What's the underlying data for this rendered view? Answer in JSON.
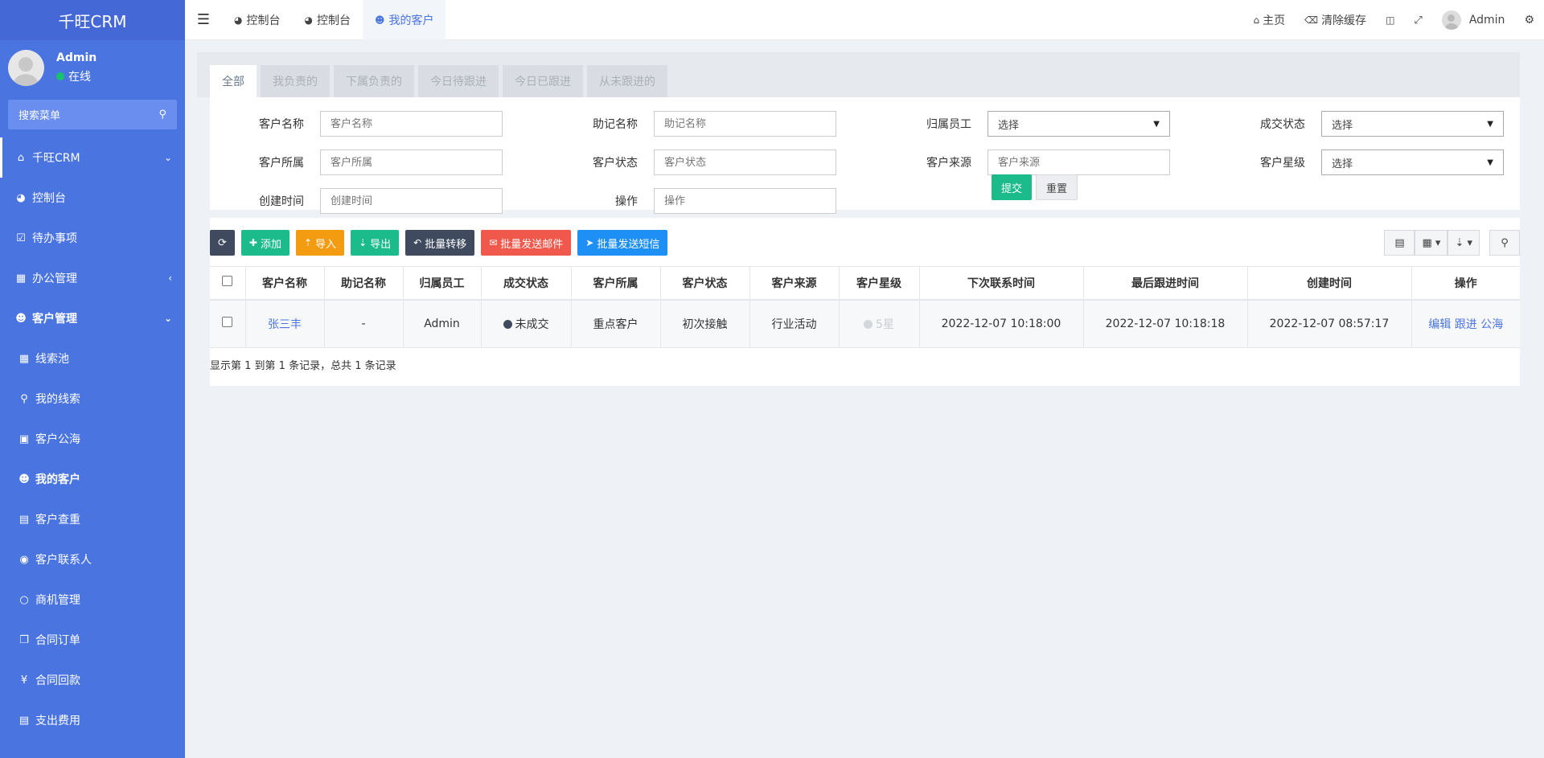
{
  "app": {
    "brand": "千旺CRM"
  },
  "user": {
    "name": "Admin",
    "status": "在线"
  },
  "sidebar": {
    "search_placeholder": "搜索菜单",
    "items": [
      {
        "label": "千旺CRM"
      },
      {
        "label": "控制台"
      },
      {
        "label": "待办事项"
      },
      {
        "label": "办公管理"
      },
      {
        "label": "客户管理"
      },
      {
        "label": "线索池"
      },
      {
        "label": "我的线索"
      },
      {
        "label": "客户公海"
      },
      {
        "label": "我的客户"
      },
      {
        "label": "客户查重"
      },
      {
        "label": "客户联系人"
      },
      {
        "label": "商机管理"
      },
      {
        "label": "合同订单"
      },
      {
        "label": "合同回款"
      },
      {
        "label": "支出费用"
      }
    ]
  },
  "topbar": {
    "tabs": [
      {
        "label": "控制台"
      },
      {
        "label": "控制台"
      },
      {
        "label": "我的客户"
      }
    ],
    "home": "主页",
    "clear_cache": "清除缓存",
    "admin": "Admin"
  },
  "filter_tabs": [
    "全部",
    "我负责的",
    "下属负责的",
    "今日待跟进",
    "今日已跟进",
    "从未跟进的"
  ],
  "filters": {
    "customer_name": {
      "label": "客户名称",
      "placeholder": "客户名称"
    },
    "mnemonic": {
      "label": "助记名称",
      "placeholder": "助记名称"
    },
    "owner": {
      "label": "归属员工",
      "value": "选择"
    },
    "deal_status": {
      "label": "成交状态",
      "value": "选择"
    },
    "belong": {
      "label": "客户所属",
      "placeholder": "客户所属"
    },
    "cust_status": {
      "label": "客户状态",
      "placeholder": "客户状态"
    },
    "source": {
      "label": "客户来源",
      "placeholder": "客户来源"
    },
    "stars": {
      "label": "客户星级",
      "value": "选择"
    },
    "created": {
      "label": "创建时间",
      "placeholder": "创建时间"
    },
    "operation": {
      "label": "操作",
      "placeholder": "操作"
    },
    "submit": "提交",
    "reset": "重置"
  },
  "toolbar": {
    "add": "添加",
    "import": "导入",
    "export": "导出",
    "transfer": "批量转移",
    "mail": "批量发送邮件",
    "sms": "批量发送短信"
  },
  "table": {
    "headers": [
      "客户名称",
      "助记名称",
      "归属员工",
      "成交状态",
      "客户所属",
      "客户状态",
      "客户来源",
      "客户星级",
      "下次联系时间",
      "最后跟进时间",
      "创建时间",
      "操作"
    ],
    "rows": [
      {
        "name": "张三丰",
        "mnemonic": "-",
        "owner": "Admin",
        "deal": "未成交",
        "belong": "重点客户",
        "status": "初次接触",
        "source": "行业活动",
        "stars": "5星",
        "next_contact": "2022-12-07 10:18:00",
        "last_follow": "2022-12-07 10:18:18",
        "created": "2022-12-07 08:57:17",
        "actions": {
          "edit": "编辑",
          "follow": "跟进",
          "pool": "公海"
        }
      }
    ],
    "pager": "显示第 1 到第 1 条记录，总共 1 条记录"
  },
  "colors": {
    "sidebar": "#4a74e0",
    "success": "#1cbb8c",
    "warning": "#f39c12",
    "dark": "#3f4a5e",
    "danger": "#f0584b",
    "primary": "#1e90f5"
  }
}
